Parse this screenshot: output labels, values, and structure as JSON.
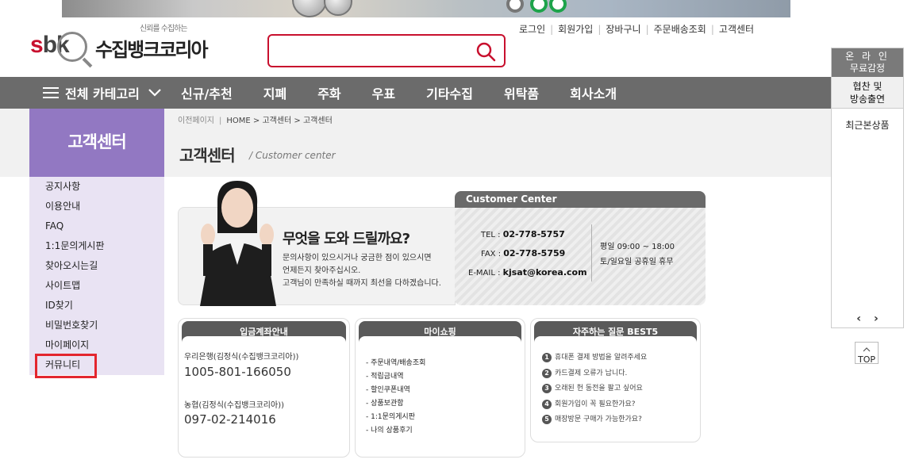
{
  "header": {
    "logo_tagline": "신뢰를 수집하는",
    "logo_en_s": "s",
    "logo_en_bk": "bk",
    "logo_ko": "수집뱅크코리아",
    "search_placeholder": "",
    "top_links": [
      "로그인",
      "회원가입",
      "장바구니",
      "주문배송조회",
      "고객센터"
    ]
  },
  "nav": {
    "all_category": "전체 카테고리",
    "items": [
      "신규/추천",
      "지폐",
      "주화",
      "우표",
      "기타수집",
      "위탁품",
      "회사소개"
    ]
  },
  "sidebar": {
    "title": "고객센터",
    "items": [
      "공지사항",
      "이용안내",
      "FAQ",
      "1:1문의게시판",
      "찾아오시는길",
      "사이트맵",
      "ID찾기",
      "비밀번호찾기",
      "마이페이지",
      "커뮤니티"
    ]
  },
  "breadcrumb": {
    "back": "이전페이지",
    "path": "HOME > 고객센터 > 고객센터"
  },
  "page": {
    "title": "고객센터",
    "subtitle": "/  Customer center"
  },
  "help": {
    "title": "무엇을 도와 드릴까요?",
    "line1": "문의사항이 있으시거나 궁금한 점이 있으시면",
    "line2": "언제든지 찾아주십시오.",
    "line3": "고객님이 만족하실 때까지 최선을 다하겠습니다."
  },
  "customer_center": {
    "header": "Customer Center",
    "tel_label": "TEL :",
    "tel": "02-778-5757",
    "fax_label": "FAX :",
    "fax": "02-778-5759",
    "email_label": "E-MAIL :",
    "email": "kjsat@korea.com",
    "hours1": "평일 09:00 ~ 18:00",
    "hours2": "토/일요일 공휴일 휴무"
  },
  "deposit": {
    "title": "입금계좌안내",
    "bank1": "우리은행(김정식(수집뱅크코리아))",
    "account1": "1005-801-166050",
    "bank2": "농협(김정식(수집뱅크코리아))",
    "account2": "097-02-214016"
  },
  "myshop": {
    "title": "마이쇼핑",
    "items": [
      "- 주문내역/배송조회",
      "- 적립금내역",
      "- 할인쿠폰내역",
      "- 상품보관함",
      "- 1:1문의게시판",
      "- 나의 상품후기"
    ]
  },
  "faq": {
    "title": "자주하는 질문 BEST5",
    "items": [
      {
        "num": "1",
        "text": "휴대폰 결제 방법을 알려주세요"
      },
      {
        "num": "2",
        "text": "카드결제 오류가 납니다."
      },
      {
        "num": "3",
        "text": "오래된 헌 동전을 팔고 싶어요"
      },
      {
        "num": "4",
        "text": "회원가입이 꼭 필요한가요?"
      },
      {
        "num": "5",
        "text": "매장방문 구매가 가능한가요?"
      }
    ]
  },
  "right_panel": {
    "appraisal_1": "온 라 인",
    "appraisal_2": "무료감정",
    "sponsor_1": "협찬 및",
    "sponsor_2": "방송출연",
    "recent": "최근본상품",
    "prev": "‹",
    "next": "›",
    "top": "TOP"
  }
}
